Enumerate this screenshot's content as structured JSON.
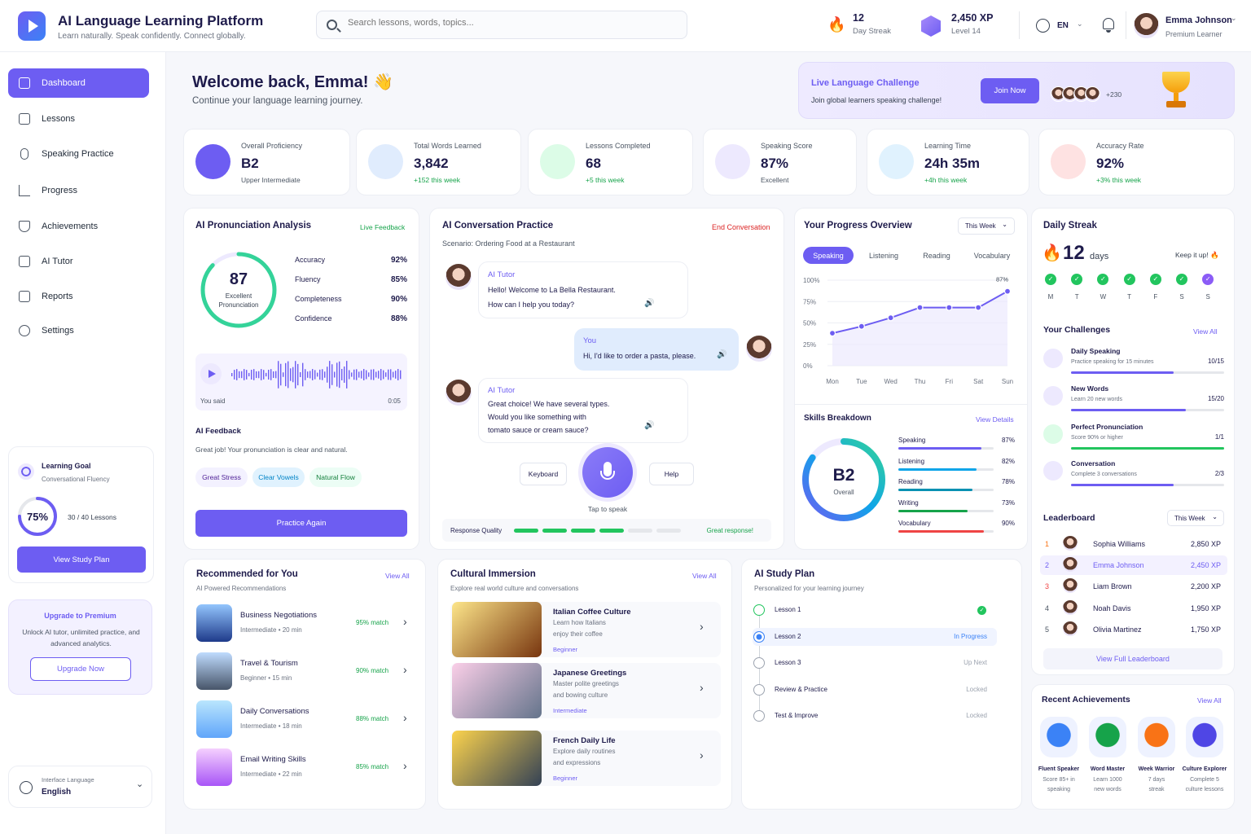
{
  "header": {
    "title": "AI Language Learning Platform",
    "subtitle": "Learn naturally. Speak confidently. Connect globally.",
    "search_placeholder": "Search lessons, words, topics...",
    "streak_value": "12",
    "streak_label": "Day Streak",
    "xp_value": "2,450 XP",
    "xp_level": "Level 14",
    "language": "EN",
    "user_name": "Emma Johnson",
    "user_tier": "Premium Learner"
  },
  "sidebar": {
    "items": [
      {
        "label": "Dashboard"
      },
      {
        "label": "Lessons"
      },
      {
        "label": "Speaking Practice"
      },
      {
        "label": "Progress"
      },
      {
        "label": "Achievements"
      },
      {
        "label": "AI Tutor"
      },
      {
        "label": "Reports"
      },
      {
        "label": "Settings"
      }
    ],
    "goal_title": "Learning Goal",
    "goal_sub": "Conversational Fluency",
    "goal_percent": "75%",
    "goal_progress": 0.75,
    "goal_lessons": "30 / 40 Lessons",
    "goal_button": "View Study Plan",
    "premium_title": "Upgrade to Premium",
    "premium_text": "Unlock AI tutor, unlimited practice, and advanced analytics.",
    "premium_button": "Upgrade Now",
    "iface_label": "Interface Language",
    "iface_value": "English"
  },
  "welcome": {
    "title": "Welcome back, Emma! 👋",
    "sub": "Continue your language learning journey."
  },
  "challenge": {
    "title": "Live Language Challenge",
    "sub": "Join global learners speaking challenge!",
    "button": "Join Now",
    "count": "+230"
  },
  "kpis": [
    {
      "label": "Overall Proficiency",
      "value": "B2",
      "delta": "Upper Intermediate"
    },
    {
      "label": "Total Words Learned",
      "value": "3,842",
      "delta": "+152 this week"
    },
    {
      "label": "Lessons Completed",
      "value": "68",
      "delta": "+5 this week"
    },
    {
      "label": "Speaking Score",
      "value": "87%",
      "delta": "Excellent"
    },
    {
      "label": "Learning Time",
      "value": "24h 35m",
      "delta": "+4h this week"
    },
    {
      "label": "Accuracy Rate",
      "value": "92%",
      "delta": "+3% this week"
    }
  ],
  "pronunciation": {
    "title": "AI Pronunciation Analysis",
    "live": "Live Feedback",
    "score": "87",
    "score_label": "Excellent Pronunciation",
    "score_value": 0.87,
    "metrics": [
      {
        "label": "Accuracy",
        "value": "92%"
      },
      {
        "label": "Fluency",
        "value": "85%"
      },
      {
        "label": "Completeness",
        "value": "90%"
      },
      {
        "label": "Confidence",
        "value": "88%"
      }
    ],
    "you_said": "You said",
    "duration": "0:05",
    "feedback_title": "AI Feedback",
    "feedback_text": "Great job! Your pronunciation is clear and natural.",
    "tags": [
      "Great Stress",
      "Clear Vowels",
      "Natural Flow"
    ],
    "button": "Practice Again"
  },
  "conversation": {
    "title": "AI Conversation Practice",
    "end": "End Conversation",
    "scenario": "Scenario: Ordering Food at a Restaurant",
    "m1_name": "AI Tutor",
    "m1_l1": "Hello! Welcome to La Bella Restaurant.",
    "m1_l2": "How can I help you today?",
    "m2_name": "You",
    "m2_l1": "Hi, I'd like to order a pasta, please.",
    "m3_name": "AI Tutor",
    "m3_l1": "Great choice! We have several types.",
    "m3_l2": "Would you like something with",
    "m3_l3": "tomato sauce or cream sauce?",
    "keyboard": "Keyboard",
    "help": "Help",
    "tap": "Tap to speak",
    "quality_label": "Response Quality",
    "quality_value": 0.67,
    "quality_note": "Great response!"
  },
  "progress": {
    "title": "Your Progress Overview",
    "range": "This Week",
    "tabs": [
      "Speaking",
      "Listening",
      "Reading",
      "Vocabulary"
    ],
    "peak_label": "87%",
    "skills_title": "Skills Breakdown",
    "skills_link": "View Details",
    "overall": "B2",
    "overall_label": "Overall",
    "skills": [
      {
        "label": "Speaking",
        "value": "87%",
        "pct": 0.87,
        "color": "#6d5df2"
      },
      {
        "label": "Listening",
        "value": "82%",
        "pct": 0.82,
        "color": "#0ea5e9"
      },
      {
        "label": "Reading",
        "value": "78%",
        "pct": 0.78,
        "color": "#0891b2"
      },
      {
        "label": "Writing",
        "value": "73%",
        "pct": 0.73,
        "color": "#16a34a"
      },
      {
        "label": "Vocabulary",
        "value": "90%",
        "pct": 0.9,
        "color": "#ef4444"
      }
    ]
  },
  "chart_data": {
    "type": "line",
    "categories": [
      "Mon",
      "Tue",
      "Wed",
      "Thu",
      "Fri",
      "Sat",
      "Sun"
    ],
    "series": [
      {
        "values": [
          38,
          46,
          56,
          68,
          68,
          68,
          87
        ]
      }
    ],
    "ylim": [
      0,
      100
    ],
    "yticks": [
      "100%",
      "75%",
      "50%",
      "25%",
      "0%"
    ],
    "grid": true
  },
  "streak": {
    "title": "Daily Streak",
    "value": "12",
    "unit": "days",
    "note": "Keep it up! 🔥",
    "days": [
      "M",
      "T",
      "W",
      "T",
      "F",
      "S",
      "S"
    ],
    "challenges_title": "Your Challenges",
    "challenges_link": "View All",
    "challenges": [
      {
        "title": "Daily Speaking",
        "sub": "Practice speaking for 15 minutes",
        "count": "10/15",
        "pct": 0.67,
        "color": "#6d5df2"
      },
      {
        "title": "New Words",
        "sub": "Learn 20 new words",
        "count": "15/20",
        "pct": 0.75,
        "color": "#6d5df2"
      },
      {
        "title": "Perfect Pronunciation",
        "sub": "Score 90% or higher",
        "count": "1/1",
        "pct": 1.0,
        "color": "#22c55e"
      },
      {
        "title": "Conversation",
        "sub": "Complete 3 conversations",
        "count": "2/3",
        "pct": 0.67,
        "color": "#6d5df2"
      }
    ]
  },
  "leaderboard": {
    "title": "Leaderboard",
    "range": "This Week",
    "rows": [
      {
        "rank": "1",
        "name": "Sophia Williams",
        "xp": "2,850 XP"
      },
      {
        "rank": "2",
        "name": "Emma Johnson",
        "xp": "2,450 XP"
      },
      {
        "rank": "3",
        "name": "Liam Brown",
        "xp": "2,200 XP"
      },
      {
        "rank": "4",
        "name": "Noah Davis",
        "xp": "1,950 XP"
      },
      {
        "rank": "5",
        "name": "Olivia Martinez",
        "xp": "1,750 XP"
      }
    ],
    "button": "View Full Leaderboard"
  },
  "recommended": {
    "title": "Recommended for You",
    "link": "View All",
    "sub": "AI Powered Recommendations",
    "items": [
      {
        "title": "Business Negotiations",
        "meta": "Intermediate • 20 min",
        "match": "95% match"
      },
      {
        "title": "Travel & Tourism",
        "meta": "Beginner • 15 min",
        "match": "90% match"
      },
      {
        "title": "Daily Conversations",
        "meta": "Intermediate • 18 min",
        "match": "88% match"
      },
      {
        "title": "Email Writing Skills",
        "meta": "Intermediate • 22 min",
        "match": "85% match"
      }
    ]
  },
  "culture": {
    "title": "Cultural Immersion",
    "link": "View All",
    "sub": "Explore real world culture and conversations",
    "items": [
      {
        "title": "Italian Coffee Culture",
        "l1": "Learn how Italians",
        "l2": "enjoy their coffee",
        "level": "Beginner"
      },
      {
        "title": "Japanese Greetings",
        "l1": "Master polite greetings",
        "l2": "and bowing culture",
        "level": "Intermediate"
      },
      {
        "title": "French Daily Life",
        "l1": "Explore daily routines",
        "l2": "and expressions",
        "level": "Beginner"
      }
    ]
  },
  "plan": {
    "title": "AI Study Plan",
    "sub": "Personalized for your learning journey",
    "steps": [
      {
        "label": "Lesson 1",
        "status": ""
      },
      {
        "label": "Lesson 2",
        "status": "In Progress"
      },
      {
        "label": "Lesson 3",
        "status": "Up Next"
      },
      {
        "label": "Review & Practice",
        "status": "Locked"
      },
      {
        "label": "Test & Improve",
        "status": "Locked"
      }
    ]
  },
  "achievements": {
    "title": "Recent Achievements",
    "link": "View All",
    "items": [
      {
        "name": "Fluent Speaker",
        "l1": "Score 85+ in",
        "l2": "speaking",
        "color": "#3b82f6"
      },
      {
        "name": "Word Master",
        "l1": "Learn 1000",
        "l2": "new words",
        "color": "#16a34a"
      },
      {
        "name": "Week Warrior",
        "l1": "7 days",
        "l2": "streak",
        "color": "#f97316"
      },
      {
        "name": "Culture Explorer",
        "l1": "Complete 5",
        "l2": "culture lessons",
        "color": "#4f46e5"
      }
    ]
  }
}
